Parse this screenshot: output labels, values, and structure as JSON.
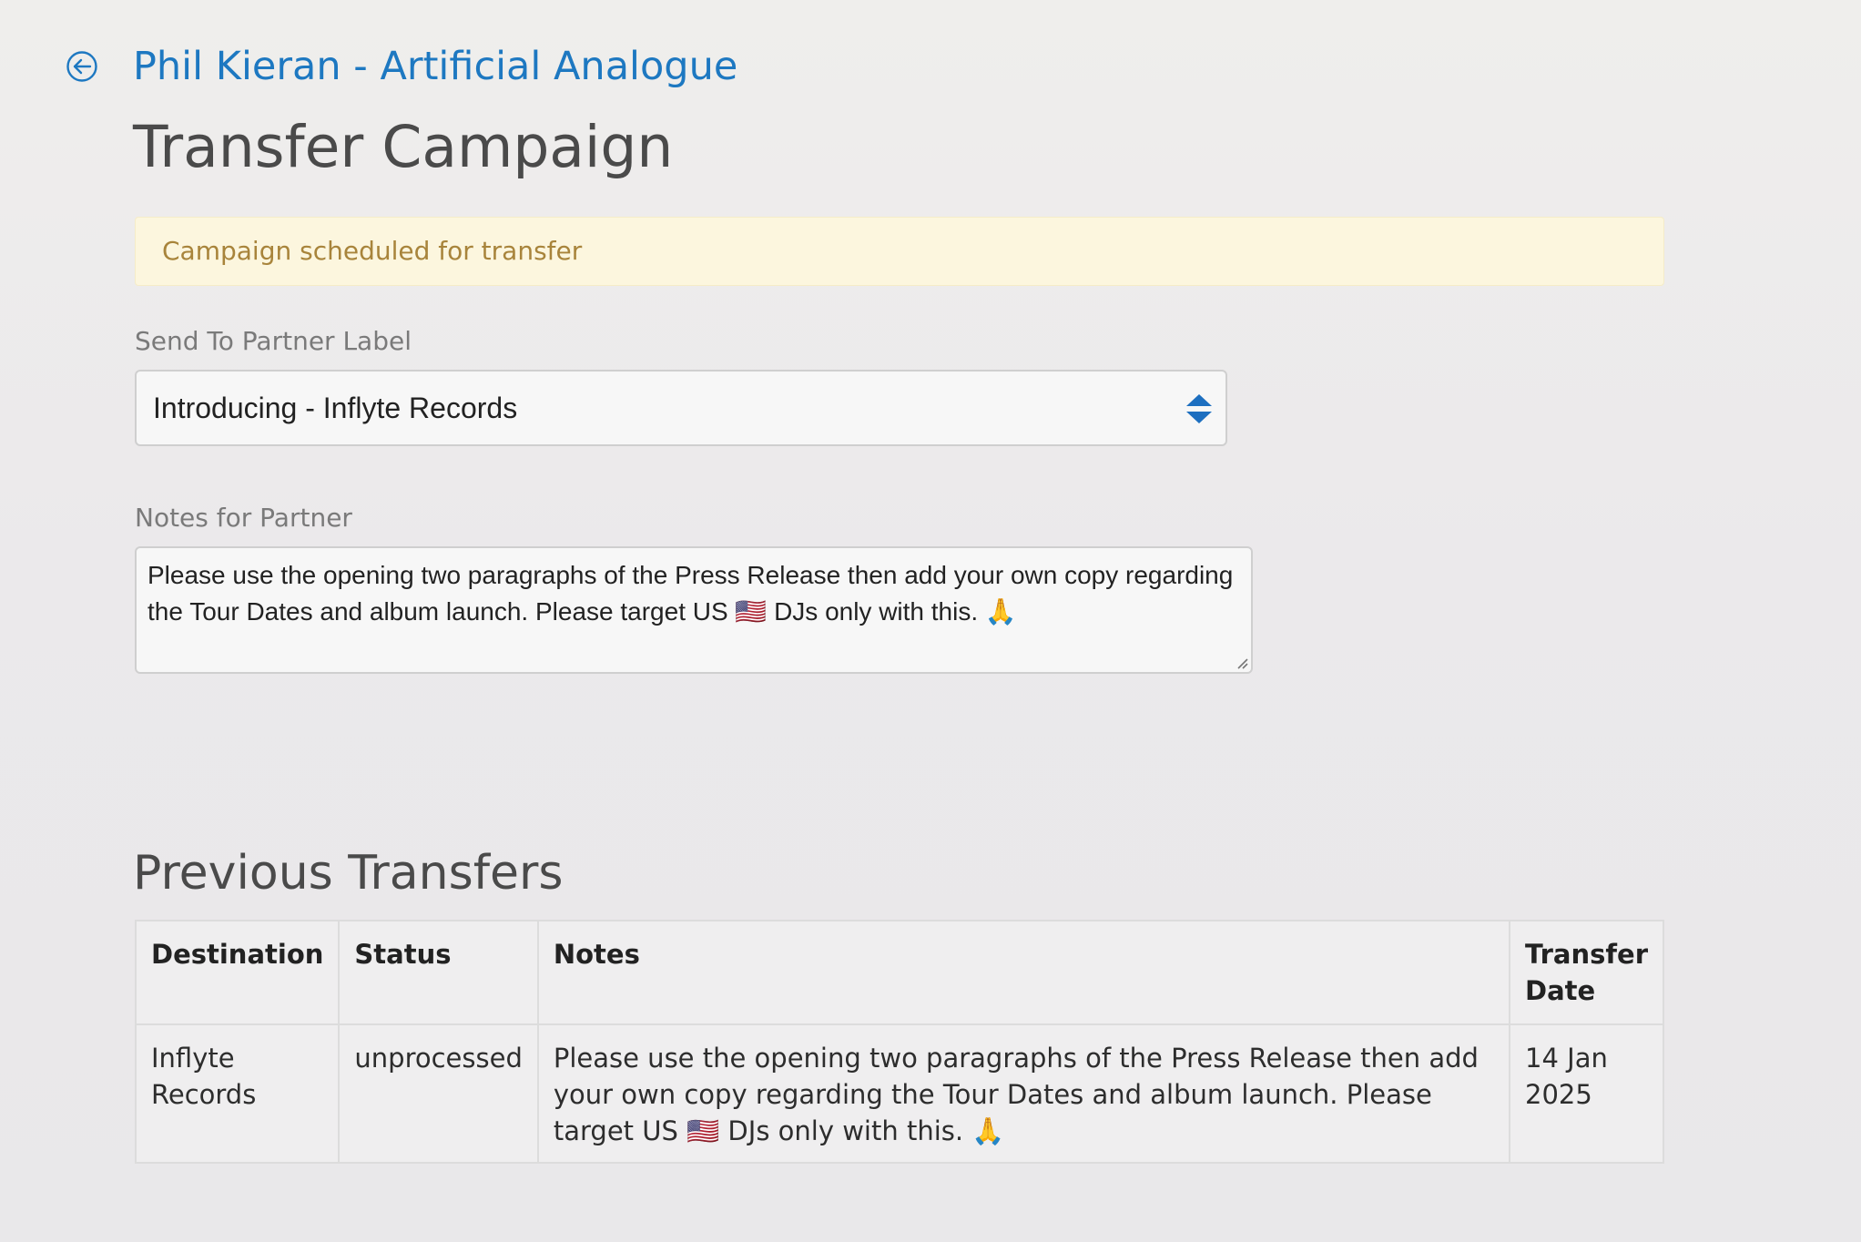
{
  "header": {
    "back_icon": "circle-arrow-left-icon",
    "breadcrumb": "Phil Kieran - Artificial Analogue",
    "title": "Transfer Campaign"
  },
  "alert": {
    "message": "Campaign scheduled for transfer"
  },
  "form": {
    "partner_label": {
      "label": "Send To Partner Label",
      "value": "Introducing - Inflyte Records",
      "icon": "select-arrows-icon"
    },
    "notes": {
      "label": "Notes for Partner",
      "value": "Please use the opening two paragraphs of the Press Release then add your own copy regarding the Tour Dates and album launch. Please target US 🇺🇸 DJs only with this. 🙏"
    }
  },
  "previous_transfers": {
    "title": "Previous Transfers",
    "columns": [
      "Destination",
      "Status",
      "Notes",
      "Transfer Date"
    ],
    "rows": [
      {
        "destination": "Inflyte Records",
        "status": "unprocessed",
        "notes": "Please use the opening two paragraphs of the Press Release then add your own copy regarding the Tour Dates and album launch. Please target US 🇺🇸 DJs only with this. 🙏",
        "transfer_date": "14 Jan 2025"
      }
    ]
  },
  "colors": {
    "link": "#1d78c1",
    "alert_bg": "#fcf6de",
    "alert_text": "#a8843b",
    "select_arrow": "#1d6fc0"
  }
}
